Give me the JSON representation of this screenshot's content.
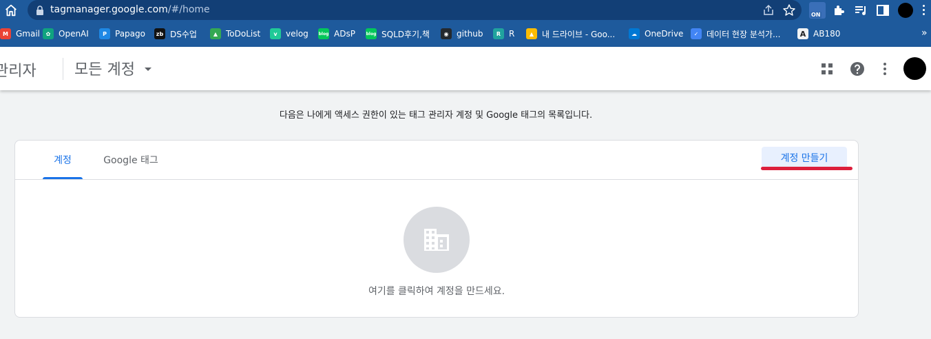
{
  "browser": {
    "url_host": "tagmanager.google.com",
    "url_path": "/#/home",
    "ext_badge": "ON",
    "more_bookmarks": "»",
    "bookmarks": [
      {
        "label": "Gmail",
        "icon": "gmail-icon",
        "color": "#ea4335",
        "glyph": "M"
      },
      {
        "label": "OpenAI",
        "icon": "openai-icon",
        "color": "#10a37f",
        "glyph": "✿"
      },
      {
        "label": "Papago",
        "icon": "papago-icon",
        "color": "#1e88e5",
        "glyph": "P"
      },
      {
        "label": "DS수업",
        "icon": "zb-icon",
        "color": "#111111",
        "glyph": "zb"
      },
      {
        "label": "ToDoList",
        "icon": "google-drive-icon",
        "color": "#34a853",
        "glyph": "▲"
      },
      {
        "label": "velog",
        "icon": "velog-icon",
        "color": "#20c997",
        "glyph": "v"
      },
      {
        "label": "ADsP",
        "icon": "blog-icon",
        "color": "#03c75a",
        "glyph": "blog"
      },
      {
        "label": "SQLD후기,책",
        "icon": "blog-icon",
        "color": "#03c75a",
        "glyph": "blog"
      },
      {
        "label": "github",
        "icon": "github-icon",
        "color": "#24292e",
        "glyph": "◉"
      },
      {
        "label": "R",
        "icon": "r-icon",
        "color": "#20a39e",
        "glyph": "R"
      },
      {
        "label": "내 드라이브 - Goo...",
        "icon": "google-drive-icon",
        "color": "#fbbc04",
        "glyph": "▲"
      },
      {
        "label": "OneDrive",
        "icon": "onedrive-icon",
        "color": "#0078d4",
        "glyph": "☁"
      },
      {
        "label": "데이터 현장 분석가...",
        "icon": "analytics-icon",
        "color": "#4285f4",
        "glyph": "✓"
      },
      {
        "label": "AB180",
        "icon": "ab180-icon",
        "color": "#f1f3f4",
        "glyph": "A"
      }
    ]
  },
  "header": {
    "product": "관리자",
    "account_selector": "모든 계정"
  },
  "main": {
    "intro": "다음은 나에게 액세스 권한이 있는 태그 관리자 계정 및 Google 태그의 목록입니다.",
    "tabs": [
      {
        "label": "계정",
        "active": true
      },
      {
        "label": "Google 태그",
        "active": false
      }
    ],
    "create_button": "계정 만들기",
    "empty_state": "여기를 클릭하여 계정을 만드세요."
  },
  "colors": {
    "chrome": "#1e5a9c",
    "accent": "#1a73e8",
    "annotation": "#dc1f3c"
  }
}
